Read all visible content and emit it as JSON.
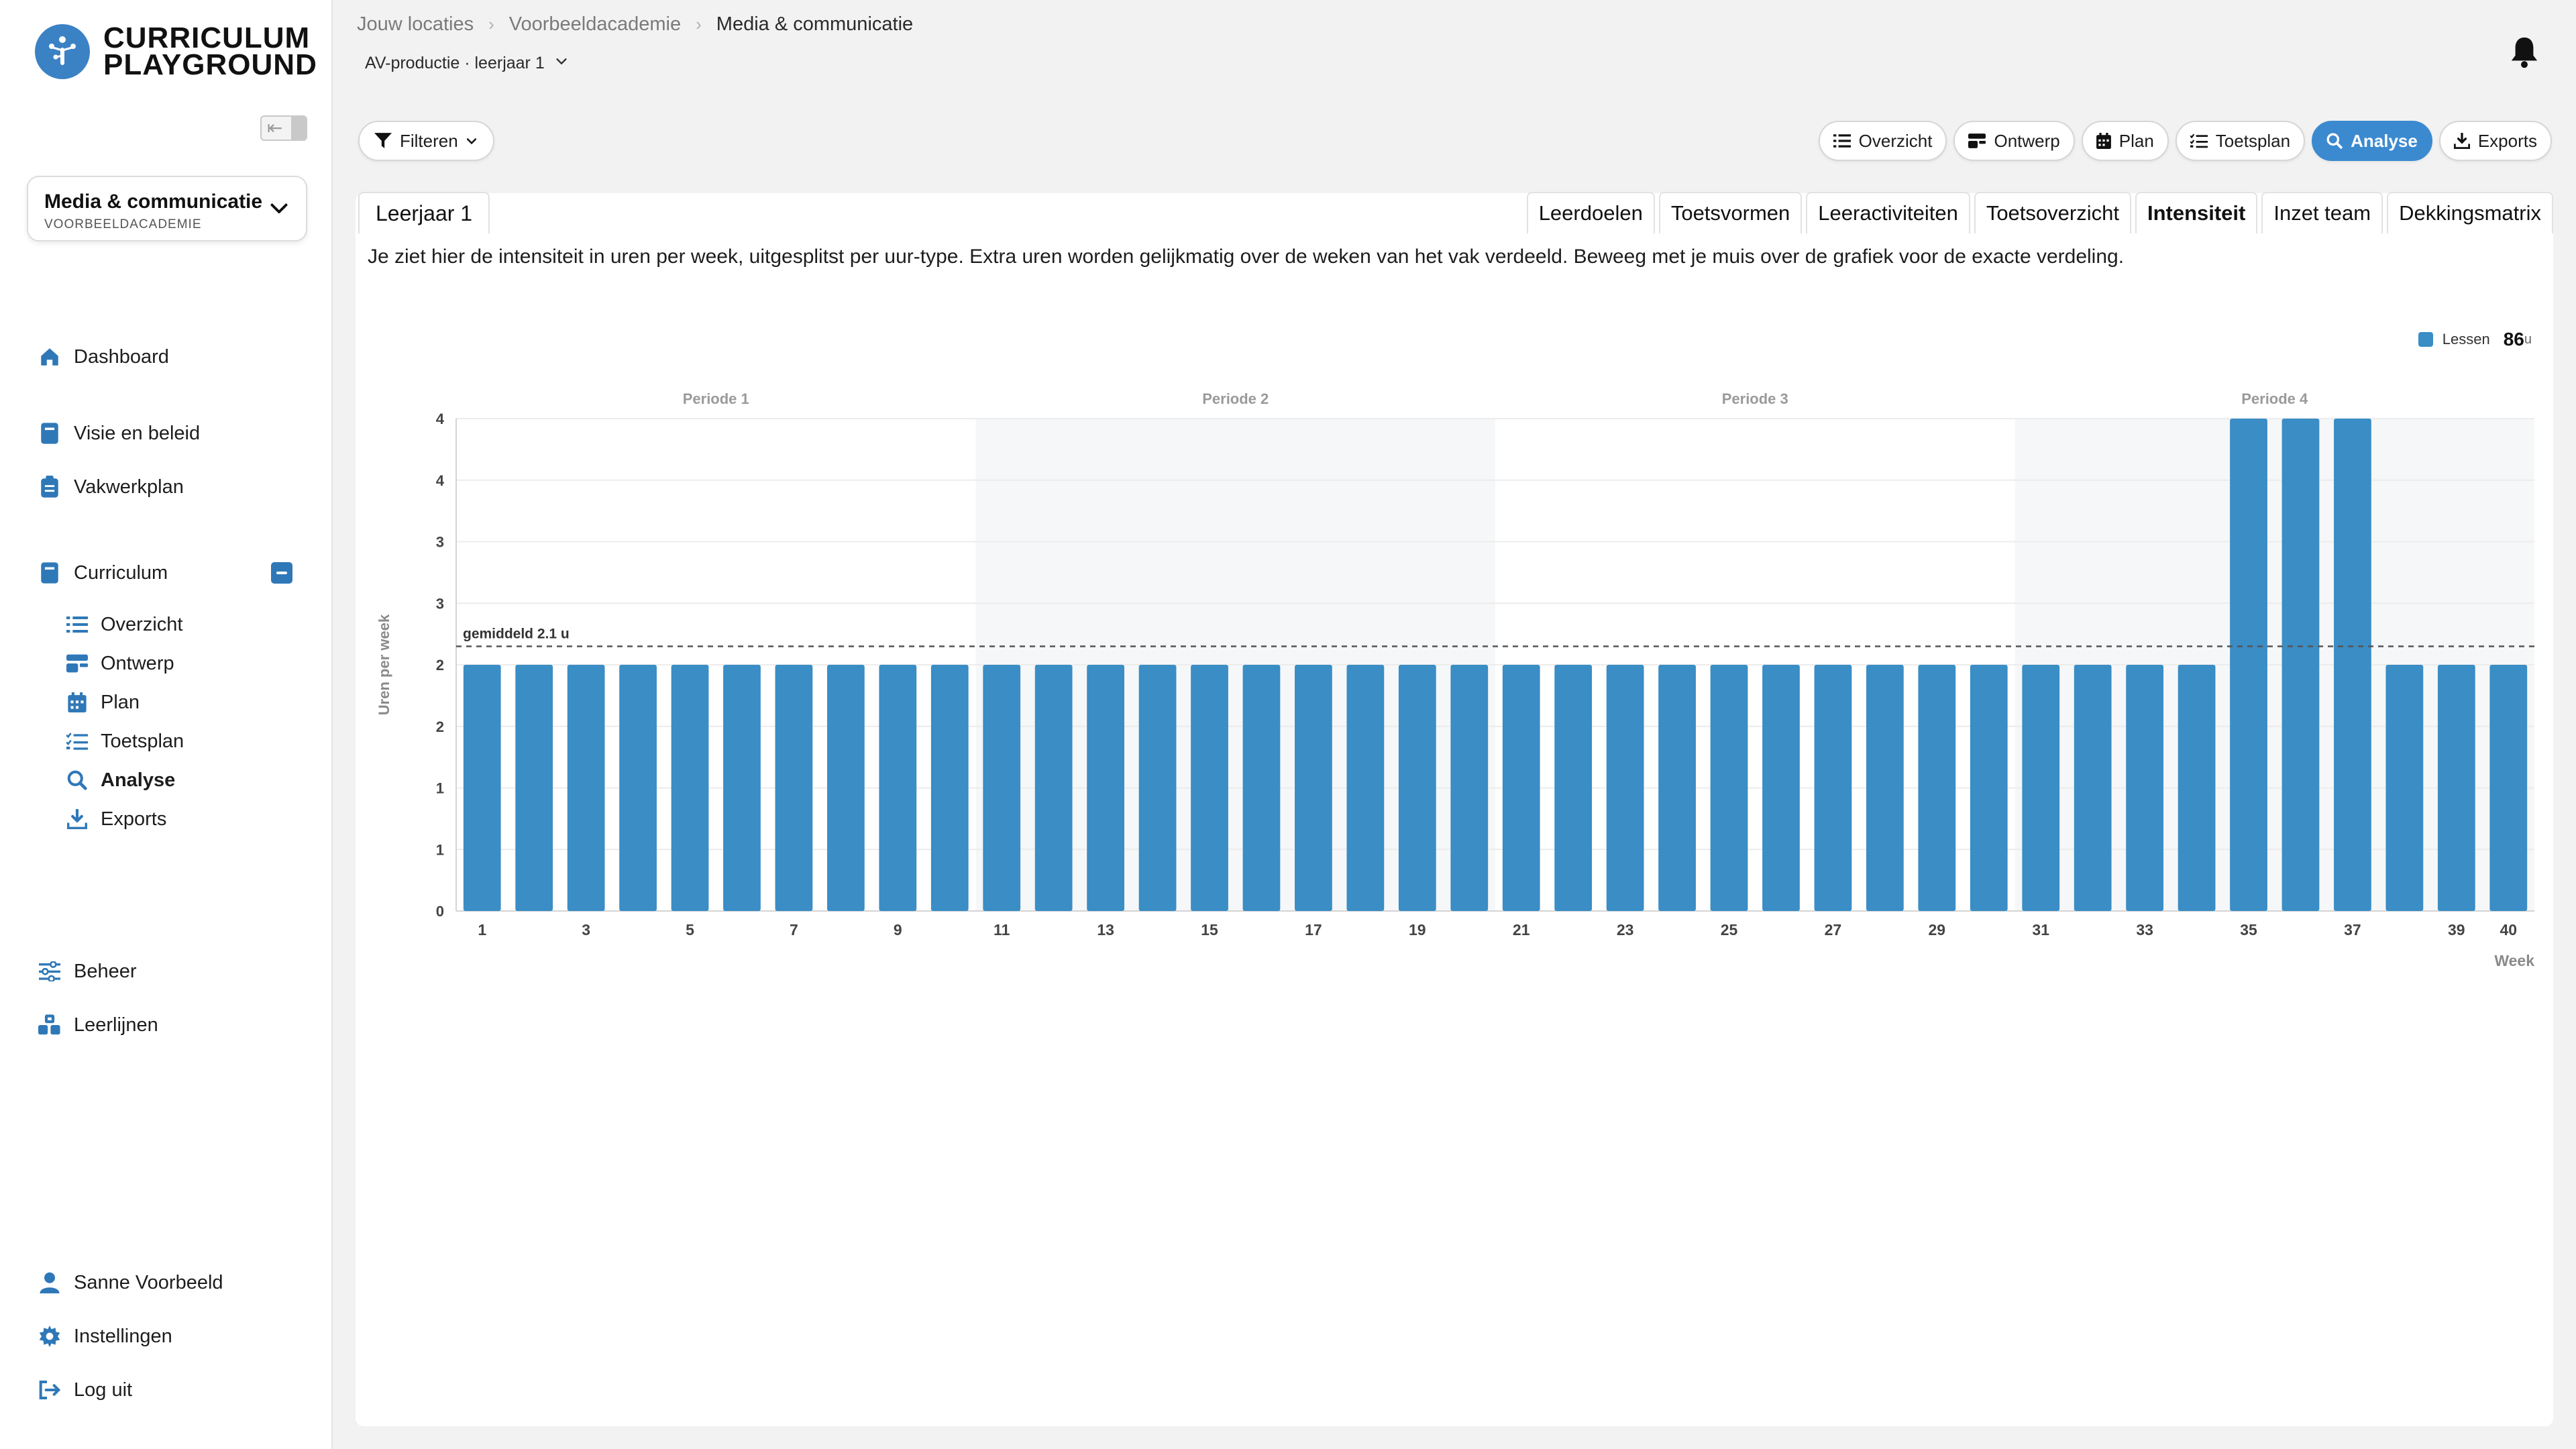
{
  "app": {
    "name_line1": "CURRICULUM",
    "name_line2": "PLAYGROUND"
  },
  "sidebar": {
    "context": {
      "title": "Media & communicatie",
      "subtitle": "VOORBEELDACADEMIE"
    },
    "items": [
      {
        "label": "Dashboard",
        "icon": "home-icon"
      },
      {
        "label": "Visie en beleid",
        "icon": "book-icon"
      },
      {
        "label": "Vakwerkplan",
        "icon": "clipboard-icon"
      },
      {
        "label": "Curriculum",
        "icon": "book-icon"
      }
    ],
    "curriculum_sub": [
      {
        "label": "Overzicht",
        "icon": "list-icon"
      },
      {
        "label": "Ontwerp",
        "icon": "layers-icon"
      },
      {
        "label": "Plan",
        "icon": "calendar-icon"
      },
      {
        "label": "Toetsplan",
        "icon": "checklist-icon"
      },
      {
        "label": "Analyse",
        "icon": "magnifier-icon"
      },
      {
        "label": "Exports",
        "icon": "download-icon"
      }
    ],
    "bottom_items": [
      {
        "label": "Beheer",
        "icon": "sliders-icon"
      },
      {
        "label": "Leerlijnen",
        "icon": "cubes-icon"
      }
    ],
    "user_items": [
      {
        "label": "Sanne Voorbeeld",
        "icon": "user-icon"
      },
      {
        "label": "Instellingen",
        "icon": "gear-icon"
      },
      {
        "label": "Log uit",
        "icon": "logout-icon"
      }
    ]
  },
  "header": {
    "breadcrumb": [
      "Jouw locaties",
      "Voorbeeldacademie",
      "Media & communicatie"
    ],
    "context_sub": "AV-productie · leerjaar 1",
    "filter_label": "Filteren",
    "views": [
      {
        "label": "Overzicht",
        "icon": "list-icon"
      },
      {
        "label": "Ontwerp",
        "icon": "layers-icon"
      },
      {
        "label": "Plan",
        "icon": "calendar-icon"
      },
      {
        "label": "Toetsplan",
        "icon": "checklist-icon"
      },
      {
        "label": "Analyse",
        "icon": "magnifier-icon"
      },
      {
        "label": "Exports",
        "icon": "download-icon"
      }
    ],
    "active_view": "Analyse"
  },
  "content": {
    "year_tab": "Leerjaar 1",
    "tabs": [
      "Leerdoelen",
      "Toetsvormen",
      "Leeractiviteiten",
      "Toetsoverzicht",
      "Intensiteit",
      "Inzet team",
      "Dekkingsmatrix"
    ],
    "active_tab": "Intensiteit",
    "description": "Je ziet hier de intensiteit in uren per week, uitgesplitst per uur-type. Extra uren worden gelijkmatig over de weken van het vak verdeeld. Beweeg met je muis over de grafiek voor de exacte verdeling."
  },
  "legend": {
    "label": "Lessen",
    "total": "86",
    "unit": "u"
  },
  "colors": {
    "accent": "#3b8ad0",
    "bar": "#3a8dc5",
    "period_shade": "#f6f7f8"
  },
  "chart_data": {
    "type": "bar",
    "ylabel": "Uren per week",
    "xlabel": "Week",
    "ylim": [
      0,
      4
    ],
    "yticks_display": [
      "0",
      "1",
      "1",
      "2",
      "2",
      "3",
      "3",
      "4",
      "4"
    ],
    "ytick_values": [
      0,
      0.5,
      1,
      1.5,
      2,
      2.5,
      3,
      3.5,
      4
    ],
    "x_tick_labels": [
      "1",
      "3",
      "5",
      "7",
      "9",
      "11",
      "13",
      "15",
      "17",
      "19",
      "21",
      "23",
      "25",
      "27",
      "29",
      "31",
      "33",
      "35",
      "37",
      "39",
      "40"
    ],
    "periods": [
      {
        "label": "Periode 1",
        "from": 1,
        "to": 10,
        "shaded": false
      },
      {
        "label": "Periode 2",
        "from": 11,
        "to": 20,
        "shaded": true
      },
      {
        "label": "Periode 3",
        "from": 21,
        "to": 30,
        "shaded": false
      },
      {
        "label": "Periode 4",
        "from": 31,
        "to": 40,
        "shaded": true
      }
    ],
    "average": {
      "value": 2.15,
      "label": "gemiddeld 2.1 u"
    },
    "series": [
      {
        "name": "Lessen",
        "x": [
          1,
          2,
          3,
          4,
          5,
          6,
          7,
          8,
          9,
          10,
          11,
          12,
          13,
          14,
          15,
          16,
          17,
          18,
          19,
          20,
          21,
          22,
          23,
          24,
          25,
          26,
          27,
          28,
          29,
          30,
          31,
          32,
          33,
          34,
          35,
          36,
          37,
          38,
          39,
          40
        ],
        "values": [
          2,
          2,
          2,
          2,
          2,
          2,
          2,
          2,
          2,
          2,
          2,
          2,
          2,
          2,
          2,
          2,
          2,
          2,
          2,
          2,
          2,
          2,
          2,
          2,
          2,
          2,
          2,
          2,
          2,
          2,
          2,
          2,
          2,
          2,
          4,
          4,
          4,
          2,
          2,
          2
        ]
      }
    ]
  }
}
